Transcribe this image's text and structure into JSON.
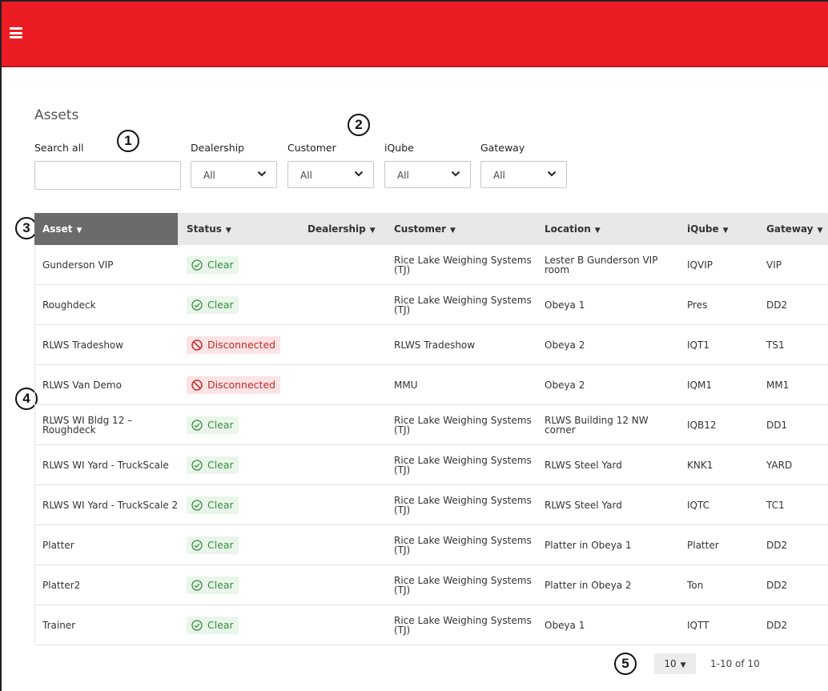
{
  "page": {
    "title": "Assets"
  },
  "filters": {
    "search_label": "Search all",
    "search_value": "",
    "dealership": {
      "label": "Dealership",
      "value": "All"
    },
    "customer": {
      "label": "Customer",
      "value": "All"
    },
    "iqube": {
      "label": "iQube",
      "value": "All"
    },
    "gateway": {
      "label": "Gateway",
      "value": "All"
    }
  },
  "callouts": {
    "c1": "1",
    "c2": "2",
    "c3": "3",
    "c4": "4",
    "c5": "5"
  },
  "table": {
    "headers": {
      "asset": "Asset",
      "status": "Status",
      "dealership": "Dealership",
      "customer": "Customer",
      "location": "Location",
      "iqube": "iQube",
      "gateway": "Gateway"
    },
    "rows": [
      {
        "asset": "Gunderson VIP",
        "status": "Clear",
        "status_type": "clear",
        "dealership": "",
        "customer": "Rice Lake Weighing Systems (TJ)",
        "location": "Lester B Gunderson VIP room",
        "iqube": "IQVIP",
        "gateway": "VIP"
      },
      {
        "asset": "Roughdeck",
        "status": "Clear",
        "status_type": "clear",
        "dealership": "",
        "customer": "Rice Lake Weighing Systems (TJ)",
        "location": "Obeya 1",
        "iqube": "Pres",
        "gateway": "DD2"
      },
      {
        "asset": "RLWS Tradeshow",
        "status": "Disconnected",
        "status_type": "disconnected",
        "dealership": "",
        "customer": "RLWS Tradeshow",
        "location": "Obeya 2",
        "iqube": "IQT1",
        "gateway": "TS1"
      },
      {
        "asset": "RLWS Van Demo",
        "status": "Disconnected",
        "status_type": "disconnected",
        "dealership": "",
        "customer": "MMU",
        "location": "Obeya 2",
        "iqube": "IQM1",
        "gateway": "MM1"
      },
      {
        "asset": "RLWS WI Bldg 12 – Roughdeck",
        "status": "Clear",
        "status_type": "clear",
        "dealership": "",
        "customer": "Rice Lake Weighing Systems (TJ)",
        "location": "RLWS Building 12 NW corner",
        "iqube": "IQB12",
        "gateway": "DD1"
      },
      {
        "asset": "RLWS WI Yard - TruckScale",
        "status": "Clear",
        "status_type": "clear",
        "dealership": "",
        "customer": "Rice Lake Weighing Systems (TJ)",
        "location": "RLWS Steel Yard",
        "iqube": "KNK1",
        "gateway": "YARD"
      },
      {
        "asset": "RLWS WI Yard - TruckScale 2",
        "status": "Clear",
        "status_type": "clear",
        "dealership": "",
        "customer": "Rice Lake Weighing Systems (TJ)",
        "location": "RLWS Steel Yard",
        "iqube": "IQTC",
        "gateway": "TC1"
      },
      {
        "asset": "Platter",
        "status": "Clear",
        "status_type": "clear",
        "dealership": "",
        "customer": "Rice Lake Weighing Systems (TJ)",
        "location": "Platter in Obeya 1",
        "iqube": "Platter",
        "gateway": "DD2"
      },
      {
        "asset": "Platter2",
        "status": "Clear",
        "status_type": "clear",
        "dealership": "",
        "customer": "Rice Lake Weighing Systems (TJ)",
        "location": "Platter in Obeya 2",
        "iqube": "Ton",
        "gateway": "DD2"
      },
      {
        "asset": "Trainer",
        "status": "Clear",
        "status_type": "clear",
        "dealership": "",
        "customer": "Rice Lake Weighing Systems (TJ)",
        "location": "Obeya 1",
        "iqube": "IQTT",
        "gateway": "DD2"
      }
    ]
  },
  "pagination": {
    "page_size": "10",
    "range": "1-10 of 10"
  },
  "colors": {
    "topbar": "#ec1c24",
    "clear": "#3a8a45",
    "disconnected": "#c12a2a"
  }
}
